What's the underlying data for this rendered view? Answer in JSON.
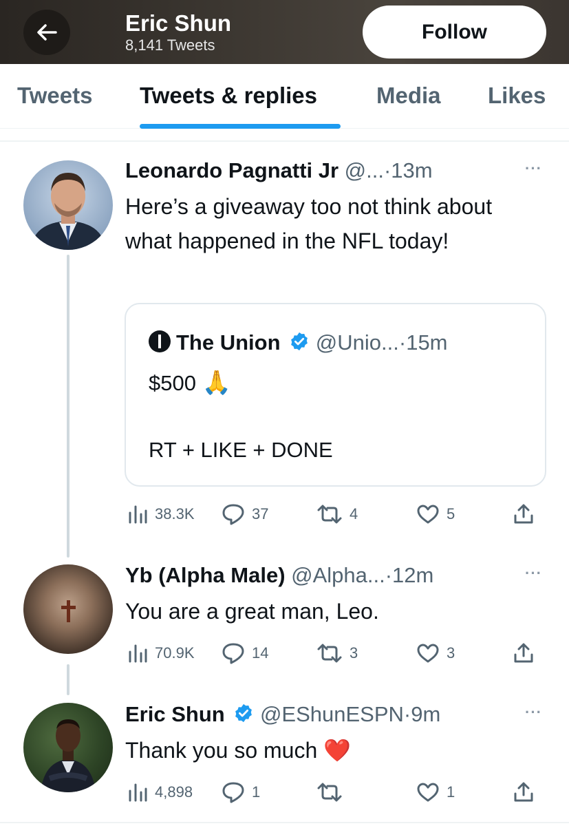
{
  "header": {
    "back_icon": "arrow-left-icon",
    "title": "Eric Shun",
    "subtitle": "8,141 Tweets",
    "follow_label": "Follow"
  },
  "tabs": [
    {
      "label": "Tweets",
      "active": false
    },
    {
      "label": "Tweets & replies",
      "active": true
    },
    {
      "label": "Media",
      "active": false
    },
    {
      "label": "Likes",
      "active": false
    }
  ],
  "colors": {
    "accent": "#1d9bf0",
    "verified": "#1d9bf0",
    "secondary_text": "#536471",
    "heart": "#e0245e"
  },
  "tweets": [
    {
      "name": "Leonardo Pagnatti Jr",
      "handle": "@...",
      "time": "·13m",
      "more": "···",
      "text": "Here’s a giveaway too not think about what happened in the NFL today!",
      "quote": {
        "name": "The Union",
        "handle": "@Unio...",
        "time": "·15m",
        "line1": "$500",
        "emoji1": "🙏",
        "line2": "RT + LIKE + DONE"
      },
      "views": "38.3K",
      "replies": "37",
      "retweets": "4",
      "likes": "5"
    },
    {
      "name": "Yb (Alpha Male)",
      "handle": "@Alpha...",
      "time": "·12m",
      "more": "···",
      "text": "You are a great man, Leo.",
      "views": "70.9K",
      "replies": "14",
      "retweets": "3",
      "likes": "3"
    },
    {
      "name": "Eric Shun",
      "handle": "@EShunESPN",
      "time": "·9m",
      "more": "···",
      "text": "Thank you so much",
      "emoji": "❤️",
      "views": "4,898",
      "replies": "1",
      "retweets": "",
      "likes": "1"
    }
  ]
}
